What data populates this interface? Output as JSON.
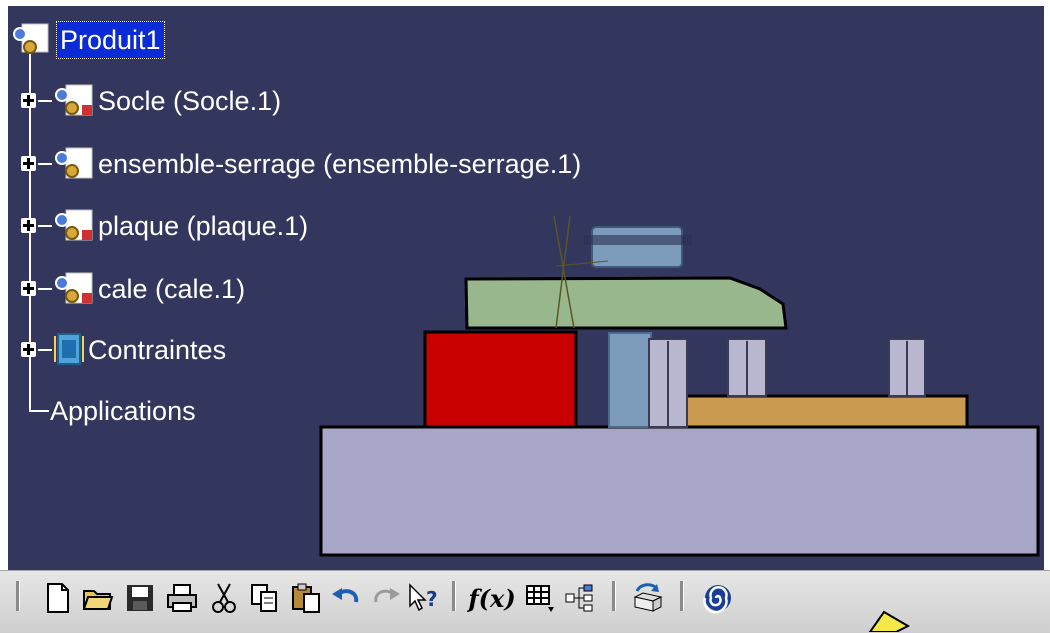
{
  "tree": {
    "root": {
      "label": "Produit1"
    },
    "items": [
      {
        "label": "Socle (Socle.1)",
        "icon": "part-icon",
        "expandable": true
      },
      {
        "label": "ensemble-serrage (ensemble-serrage.1)",
        "icon": "product-icon",
        "expandable": true
      },
      {
        "label": "plaque (plaque.1)",
        "icon": "part-icon",
        "expandable": true
      },
      {
        "label": "cale (cale.1)",
        "icon": "part-icon",
        "expandable": true
      },
      {
        "label": "Contraintes",
        "icon": "constraints-icon",
        "expandable": true
      },
      {
        "label": "Applications",
        "icon": "",
        "expandable": false
      }
    ]
  },
  "colors": {
    "viewport_bg": "#33365d",
    "selection": "#0a2bd6",
    "base": "#a7a6c6",
    "red_block": "#c80000",
    "green_clamp": "#98b78d",
    "plate": "#c99a4f",
    "screw": "#7d9cbc",
    "pin": "#b9b7cf"
  },
  "toolbar": {
    "buttons": [
      {
        "name": "new-document-icon"
      },
      {
        "name": "open-folder-icon"
      },
      {
        "name": "save-icon"
      },
      {
        "name": "print-icon"
      },
      {
        "name": "cut-icon"
      },
      {
        "name": "copy-icon"
      },
      {
        "name": "paste-icon"
      },
      {
        "name": "undo-icon"
      },
      {
        "name": "redo-icon"
      },
      {
        "name": "whats-this-help-icon"
      },
      {
        "name": "formula-icon",
        "text": "f(x)"
      },
      {
        "name": "table-icon"
      },
      {
        "name": "tree-view-icon"
      },
      {
        "name": "update-icon"
      },
      {
        "name": "spiral-icon"
      }
    ]
  }
}
